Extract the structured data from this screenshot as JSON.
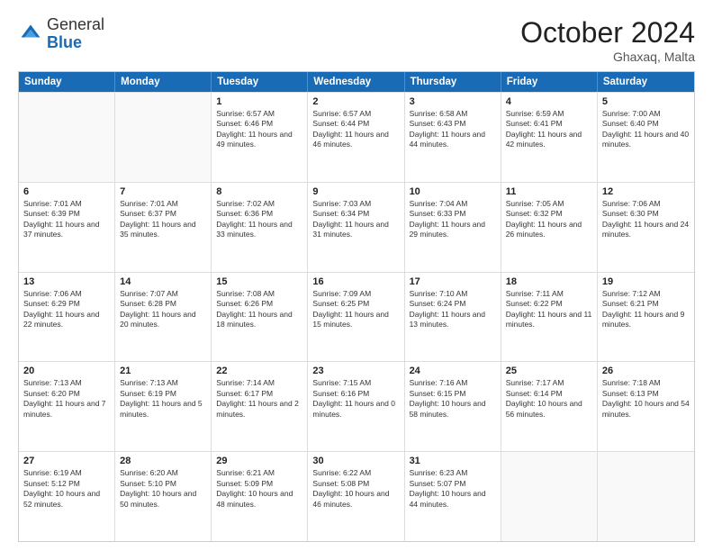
{
  "logo": {
    "general": "General",
    "blue": "Blue"
  },
  "title": "October 2024",
  "subtitle": "Ghaxaq, Malta",
  "days": [
    "Sunday",
    "Monday",
    "Tuesday",
    "Wednesday",
    "Thursday",
    "Friday",
    "Saturday"
  ],
  "weeks": [
    [
      {
        "date": "",
        "empty": true
      },
      {
        "date": "",
        "empty": true
      },
      {
        "date": "1",
        "sunrise": "Sunrise: 6:57 AM",
        "sunset": "Sunset: 6:46 PM",
        "daylight": "Daylight: 11 hours and 49 minutes."
      },
      {
        "date": "2",
        "sunrise": "Sunrise: 6:57 AM",
        "sunset": "Sunset: 6:44 PM",
        "daylight": "Daylight: 11 hours and 46 minutes."
      },
      {
        "date": "3",
        "sunrise": "Sunrise: 6:58 AM",
        "sunset": "Sunset: 6:43 PM",
        "daylight": "Daylight: 11 hours and 44 minutes."
      },
      {
        "date": "4",
        "sunrise": "Sunrise: 6:59 AM",
        "sunset": "Sunset: 6:41 PM",
        "daylight": "Daylight: 11 hours and 42 minutes."
      },
      {
        "date": "5",
        "sunrise": "Sunrise: 7:00 AM",
        "sunset": "Sunset: 6:40 PM",
        "daylight": "Daylight: 11 hours and 40 minutes."
      }
    ],
    [
      {
        "date": "6",
        "sunrise": "Sunrise: 7:01 AM",
        "sunset": "Sunset: 6:39 PM",
        "daylight": "Daylight: 11 hours and 37 minutes."
      },
      {
        "date": "7",
        "sunrise": "Sunrise: 7:01 AM",
        "sunset": "Sunset: 6:37 PM",
        "daylight": "Daylight: 11 hours and 35 minutes."
      },
      {
        "date": "8",
        "sunrise": "Sunrise: 7:02 AM",
        "sunset": "Sunset: 6:36 PM",
        "daylight": "Daylight: 11 hours and 33 minutes."
      },
      {
        "date": "9",
        "sunrise": "Sunrise: 7:03 AM",
        "sunset": "Sunset: 6:34 PM",
        "daylight": "Daylight: 11 hours and 31 minutes."
      },
      {
        "date": "10",
        "sunrise": "Sunrise: 7:04 AM",
        "sunset": "Sunset: 6:33 PM",
        "daylight": "Daylight: 11 hours and 29 minutes."
      },
      {
        "date": "11",
        "sunrise": "Sunrise: 7:05 AM",
        "sunset": "Sunset: 6:32 PM",
        "daylight": "Daylight: 11 hours and 26 minutes."
      },
      {
        "date": "12",
        "sunrise": "Sunrise: 7:06 AM",
        "sunset": "Sunset: 6:30 PM",
        "daylight": "Daylight: 11 hours and 24 minutes."
      }
    ],
    [
      {
        "date": "13",
        "sunrise": "Sunrise: 7:06 AM",
        "sunset": "Sunset: 6:29 PM",
        "daylight": "Daylight: 11 hours and 22 minutes."
      },
      {
        "date": "14",
        "sunrise": "Sunrise: 7:07 AM",
        "sunset": "Sunset: 6:28 PM",
        "daylight": "Daylight: 11 hours and 20 minutes."
      },
      {
        "date": "15",
        "sunrise": "Sunrise: 7:08 AM",
        "sunset": "Sunset: 6:26 PM",
        "daylight": "Daylight: 11 hours and 18 minutes."
      },
      {
        "date": "16",
        "sunrise": "Sunrise: 7:09 AM",
        "sunset": "Sunset: 6:25 PM",
        "daylight": "Daylight: 11 hours and 15 minutes."
      },
      {
        "date": "17",
        "sunrise": "Sunrise: 7:10 AM",
        "sunset": "Sunset: 6:24 PM",
        "daylight": "Daylight: 11 hours and 13 minutes."
      },
      {
        "date": "18",
        "sunrise": "Sunrise: 7:11 AM",
        "sunset": "Sunset: 6:22 PM",
        "daylight": "Daylight: 11 hours and 11 minutes."
      },
      {
        "date": "19",
        "sunrise": "Sunrise: 7:12 AM",
        "sunset": "Sunset: 6:21 PM",
        "daylight": "Daylight: 11 hours and 9 minutes."
      }
    ],
    [
      {
        "date": "20",
        "sunrise": "Sunrise: 7:13 AM",
        "sunset": "Sunset: 6:20 PM",
        "daylight": "Daylight: 11 hours and 7 minutes."
      },
      {
        "date": "21",
        "sunrise": "Sunrise: 7:13 AM",
        "sunset": "Sunset: 6:19 PM",
        "daylight": "Daylight: 11 hours and 5 minutes."
      },
      {
        "date": "22",
        "sunrise": "Sunrise: 7:14 AM",
        "sunset": "Sunset: 6:17 PM",
        "daylight": "Daylight: 11 hours and 2 minutes."
      },
      {
        "date": "23",
        "sunrise": "Sunrise: 7:15 AM",
        "sunset": "Sunset: 6:16 PM",
        "daylight": "Daylight: 11 hours and 0 minutes."
      },
      {
        "date": "24",
        "sunrise": "Sunrise: 7:16 AM",
        "sunset": "Sunset: 6:15 PM",
        "daylight": "Daylight: 10 hours and 58 minutes."
      },
      {
        "date": "25",
        "sunrise": "Sunrise: 7:17 AM",
        "sunset": "Sunset: 6:14 PM",
        "daylight": "Daylight: 10 hours and 56 minutes."
      },
      {
        "date": "26",
        "sunrise": "Sunrise: 7:18 AM",
        "sunset": "Sunset: 6:13 PM",
        "daylight": "Daylight: 10 hours and 54 minutes."
      }
    ],
    [
      {
        "date": "27",
        "sunrise": "Sunrise: 6:19 AM",
        "sunset": "Sunset: 5:12 PM",
        "daylight": "Daylight: 10 hours and 52 minutes."
      },
      {
        "date": "28",
        "sunrise": "Sunrise: 6:20 AM",
        "sunset": "Sunset: 5:10 PM",
        "daylight": "Daylight: 10 hours and 50 minutes."
      },
      {
        "date": "29",
        "sunrise": "Sunrise: 6:21 AM",
        "sunset": "Sunset: 5:09 PM",
        "daylight": "Daylight: 10 hours and 48 minutes."
      },
      {
        "date": "30",
        "sunrise": "Sunrise: 6:22 AM",
        "sunset": "Sunset: 5:08 PM",
        "daylight": "Daylight: 10 hours and 46 minutes."
      },
      {
        "date": "31",
        "sunrise": "Sunrise: 6:23 AM",
        "sunset": "Sunset: 5:07 PM",
        "daylight": "Daylight: 10 hours and 44 minutes."
      },
      {
        "date": "",
        "empty": true
      },
      {
        "date": "",
        "empty": true
      }
    ]
  ]
}
